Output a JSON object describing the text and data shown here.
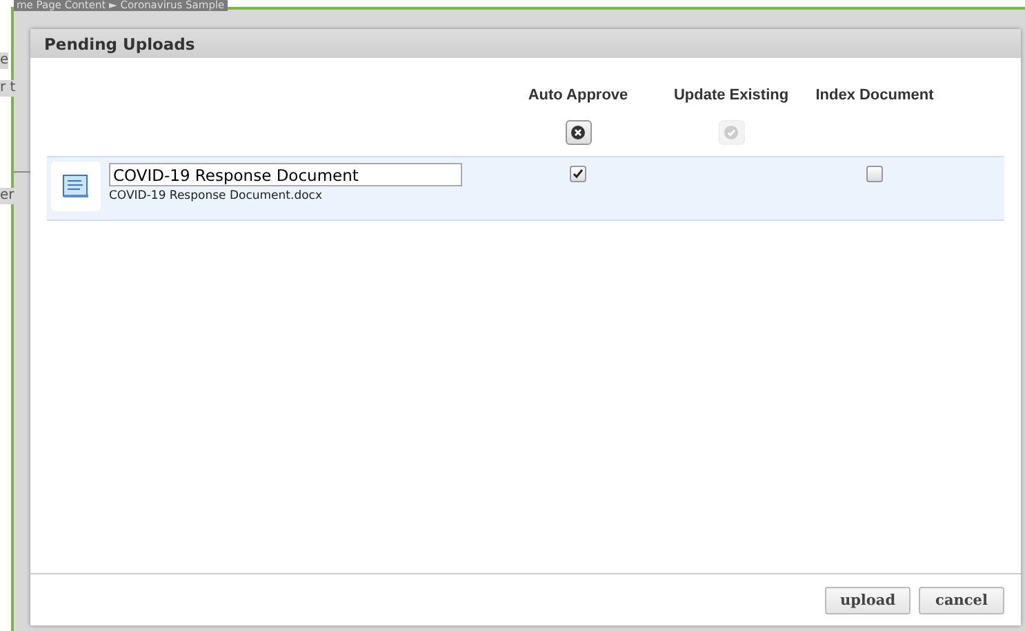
{
  "background": {
    "breadcrumb": "me Page Content ► Coronavirus Sample",
    "fragments": [
      "e",
      "r t",
      "er"
    ]
  },
  "dialog": {
    "title": "Pending Uploads",
    "columns": [
      {
        "label": "Auto Approve",
        "toggle": {
          "kind": "clear",
          "disabled": false
        }
      },
      {
        "label": "Update Existing",
        "toggle": {
          "kind": "check",
          "disabled": true
        }
      },
      {
        "label": "Index Document"
      }
    ],
    "rows": [
      {
        "title": "COVID-19 Response Document",
        "filename": "COVID-19 Response Document.docx",
        "auto_approve": {
          "checked": true
        },
        "index_document": {
          "checked": false
        }
      }
    ],
    "buttons": [
      "upload",
      "cancel"
    ]
  }
}
